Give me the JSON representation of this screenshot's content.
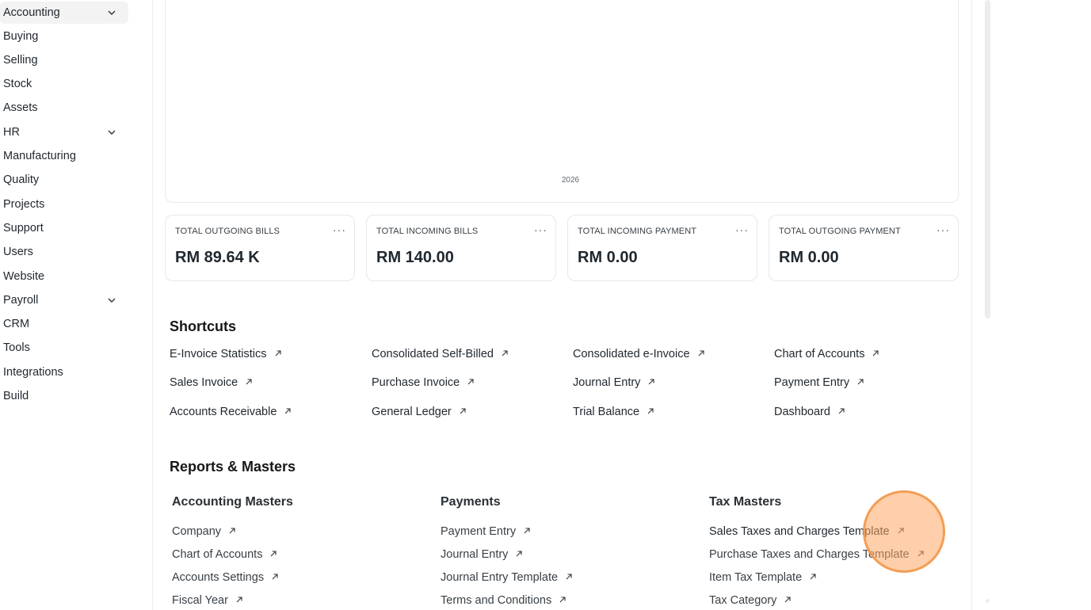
{
  "sidebar": {
    "items": [
      {
        "label": "Accounting",
        "has_chevron": true,
        "active": true
      },
      {
        "label": "Buying",
        "has_chevron": false
      },
      {
        "label": "Selling",
        "has_chevron": false
      },
      {
        "label": "Stock",
        "has_chevron": false
      },
      {
        "label": "Assets",
        "has_chevron": false
      },
      {
        "label": "HR",
        "has_chevron": true
      },
      {
        "label": "Manufacturing",
        "has_chevron": false
      },
      {
        "label": "Quality",
        "has_chevron": false
      },
      {
        "label": "Projects",
        "has_chevron": false
      },
      {
        "label": "Support",
        "has_chevron": false
      },
      {
        "label": "Users",
        "has_chevron": false
      },
      {
        "label": "Website",
        "has_chevron": false
      },
      {
        "label": "Payroll",
        "has_chevron": true
      },
      {
        "label": "CRM",
        "has_chevron": false
      },
      {
        "label": "Tools",
        "has_chevron": false
      },
      {
        "label": "Integrations",
        "has_chevron": false
      },
      {
        "label": "Build",
        "has_chevron": false
      }
    ]
  },
  "chart": {
    "x_tick": "2026"
  },
  "number_cards": [
    {
      "label": "TOTAL OUTGOING BILLS",
      "value": "RM 89.64 K",
      "menu": "···"
    },
    {
      "label": "TOTAL INCOMING BILLS",
      "value": "RM 140.00",
      "menu": "···"
    },
    {
      "label": "TOTAL INCOMING PAYMENT",
      "value": "RM 0.00",
      "menu": "···"
    },
    {
      "label": "TOTAL OUTGOING PAYMENT",
      "value": "RM 0.00",
      "menu": "···"
    }
  ],
  "shortcuts": {
    "title": "Shortcuts",
    "items": [
      "E-Invoice Statistics",
      "Consolidated Self-Billed",
      "Consolidated e-Invoice",
      "Chart of Accounts",
      "Sales Invoice",
      "Purchase Invoice",
      "Journal Entry",
      "Payment Entry",
      "Accounts Receivable",
      "General Ledger",
      "Trial Balance",
      "Dashboard"
    ]
  },
  "reports": {
    "title": "Reports & Masters",
    "columns": [
      {
        "title": "Accounting Masters",
        "links": [
          "Company",
          "Chart of Accounts",
          "Accounts Settings",
          "Fiscal Year"
        ]
      },
      {
        "title": "Payments",
        "links": [
          "Payment Entry",
          "Journal Entry",
          "Journal Entry Template",
          "Terms and Conditions"
        ]
      },
      {
        "title": "Tax Masters",
        "links": [
          "Sales Taxes and Charges Template",
          "Purchase Taxes and Charges Template",
          "Item Tax Template",
          "Tax Category"
        ]
      }
    ]
  },
  "colors": {
    "text": "#1f272e",
    "border": "#e6e8ea",
    "active_bg": "#f3f3f3",
    "cursor_highlight": "#f5a05f"
  }
}
